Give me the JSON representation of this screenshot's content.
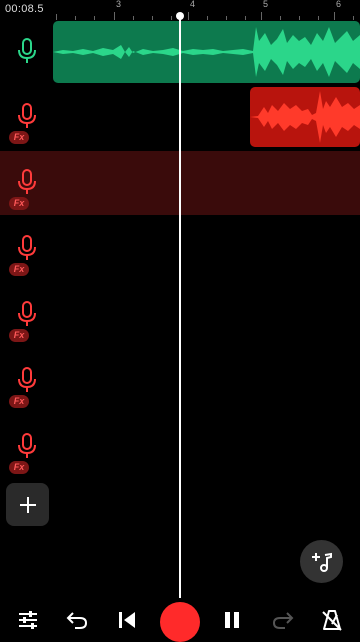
{
  "timeline": {
    "time_readout": "00:08.5",
    "ruler_labels": [
      "3",
      "4",
      "5",
      "6"
    ]
  },
  "tracks": [
    {
      "mic_color": "#2bd68a",
      "fx": ""
    },
    {
      "mic_color": "#ff3b3b",
      "fx": "Fx"
    },
    {
      "mic_color": "#ff3b3b",
      "fx": "Fx"
    },
    {
      "mic_color": "#ff3b3b",
      "fx": "Fx"
    },
    {
      "mic_color": "#ff3b3b",
      "fx": "Fx"
    },
    {
      "mic_color": "#ff3b3b",
      "fx": "Fx"
    },
    {
      "mic_color": "#ff3b3b",
      "fx": "Fx"
    }
  ],
  "colors": {
    "green_clip": "#0d7a4e",
    "green_wave": "#2bd68a",
    "red_clip": "#b8140d",
    "red_wave": "#ff3a2a",
    "record": "#ff2a2a",
    "selected_track": "#3a0b0b"
  },
  "icons": {
    "add_track": "plus-icon",
    "add_music": "music-plus-icon",
    "toolbar": [
      "sliders-icon",
      "undo-icon",
      "skip-back-icon",
      "record-icon",
      "pause-icon",
      "redo-icon",
      "metronome-off-icon"
    ]
  }
}
